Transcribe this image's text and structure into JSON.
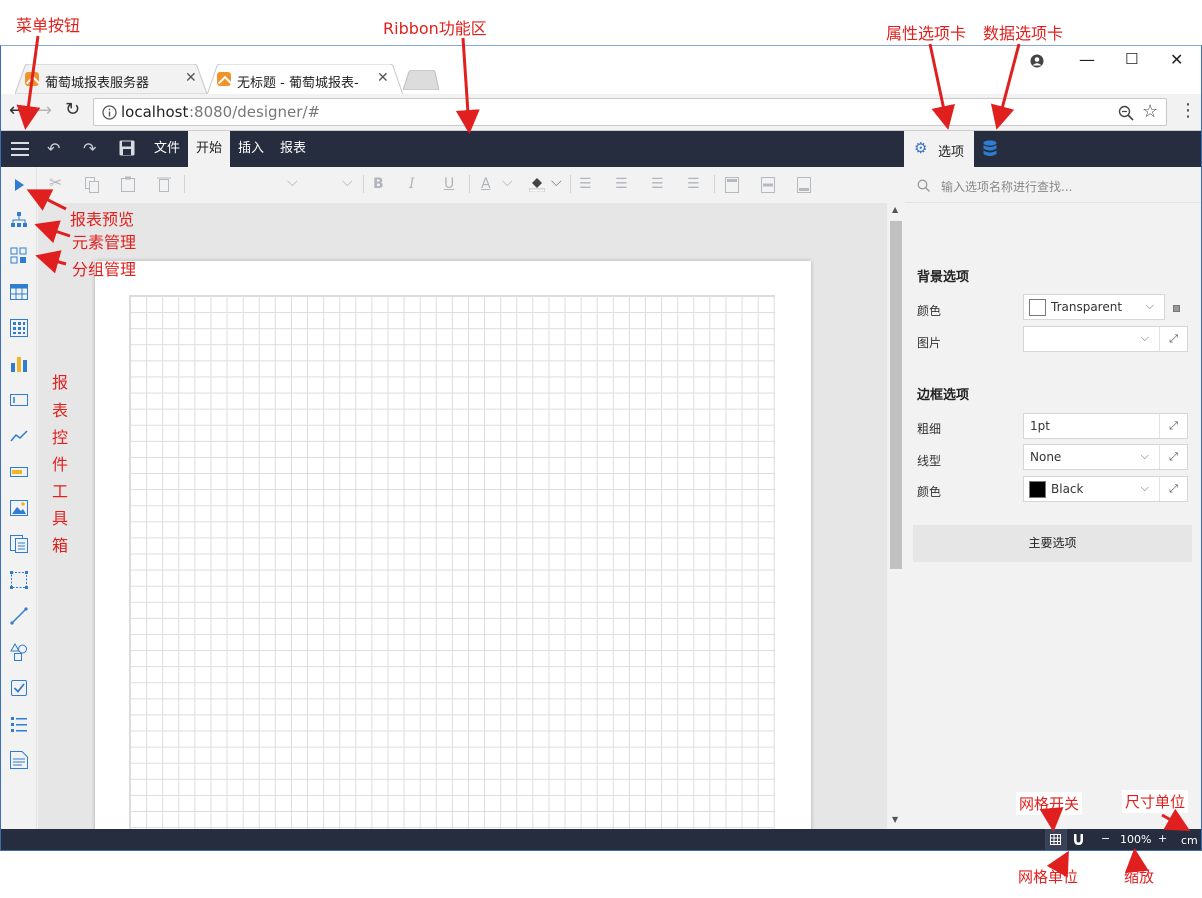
{
  "annotations": {
    "menu_button": "菜单按钮",
    "ribbon": "Ribbon功能区",
    "property_tab": "属性选项卡",
    "data_tab": "数据选项卡",
    "report_preview": "报表预览",
    "element_manager": "元素管理",
    "group_manager": "分组管理",
    "toolbox_chars": [
      "报",
      "表",
      "控",
      "件",
      "工",
      "具",
      "箱"
    ],
    "grid_toggle": "网格开关",
    "size_unit": "尺寸单位",
    "grid_unit": "网格单位",
    "zoom": "缩放"
  },
  "browser": {
    "tabs": [
      {
        "label": "葡萄城报表服务器"
      },
      {
        "label": "无标题 - 葡萄城报表-在线"
      }
    ],
    "url_host": "localhost",
    "url_rest": ":8080/designer/#"
  },
  "ribbon": {
    "tabs": [
      "文件",
      "开始",
      "插入",
      "报表"
    ],
    "active_tab": "开始",
    "right_tab_label": "选项"
  },
  "panel": {
    "search_placeholder": "输入选项名称进行查找...",
    "background_section": "背景选项",
    "bg_color_label": "颜色",
    "bg_color_value": "Transparent",
    "bg_image_label": "图片",
    "border_section": "边框选项",
    "border_width_label": "粗细",
    "border_width_value": "1pt",
    "border_style_label": "线型",
    "border_style_value": "None",
    "border_color_label": "颜色",
    "border_color_value": "Black",
    "main_options": "主要选项"
  },
  "statusbar": {
    "zoom_minus": "−",
    "zoom_value": "100%",
    "zoom_plus": "+",
    "unit": "cm"
  },
  "colors": {
    "dark_bar": "#252d3f",
    "accent_blue": "#2f7dd1",
    "annotation_red": "#e0201e"
  }
}
